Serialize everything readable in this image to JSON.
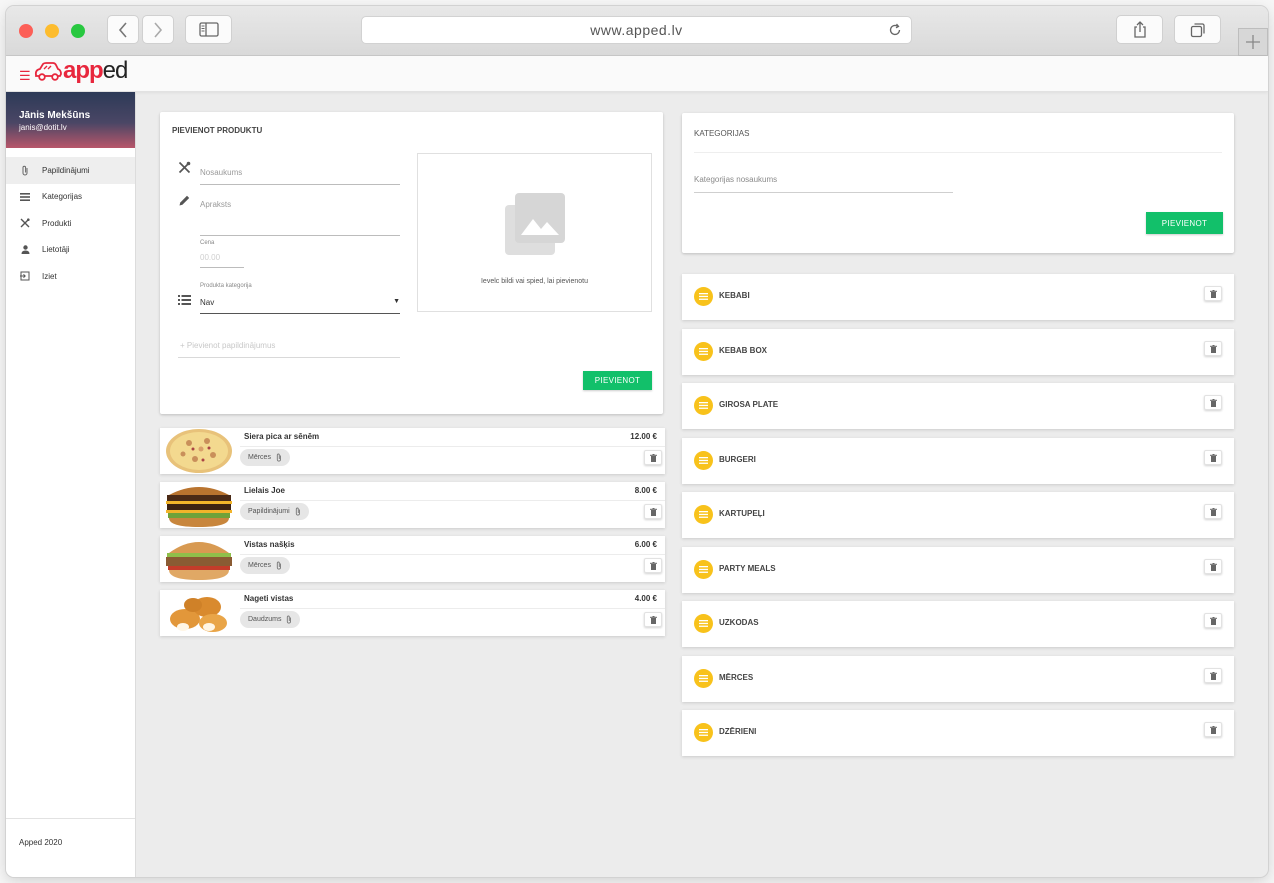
{
  "browser": {
    "url": "www.apped.lv"
  },
  "app": {
    "logo_part1": "app",
    "logo_part2": "ed",
    "user": {
      "name": "Jānis Mekšūns",
      "email": "janis@dotit.lv"
    },
    "nav": [
      {
        "label": "Papildinājumi",
        "icon": "paperclip-icon",
        "active": true
      },
      {
        "label": "Kategorijas",
        "icon": "list-icon",
        "active": false
      },
      {
        "label": "Produkti",
        "icon": "utensils-icon",
        "active": false
      },
      {
        "label": "Lietotāji",
        "icon": "person-icon",
        "active": false
      },
      {
        "label": "Iziet",
        "icon": "logout-icon",
        "active": false
      }
    ],
    "footer": "Apped 2020"
  },
  "add_product": {
    "title": "PIEVIENOT PRODUKTU",
    "name_placeholder": "Nosaukums",
    "description_placeholder": "Apraksts",
    "price_label": "Cena",
    "price_placeholder": "00.00",
    "category_label": "Produkta kategorija",
    "category_value": "Nav",
    "addon_placeholder": "+ Pievienot papildinājumus",
    "image_hint": "Ievelc bildi vai spied, lai pievienotu",
    "submit_label": "PIEVIENOT"
  },
  "products": [
    {
      "name": "Siera pica ar sēnēm",
      "price": "12.00 €",
      "tag": "Mērces",
      "image": "pizza"
    },
    {
      "name": "Lielais Joe",
      "price": "8.00 €",
      "tag": "Papildinājumi",
      "image": "burger-double"
    },
    {
      "name": "Vistas našķis",
      "price": "6.00 €",
      "tag": "Mērces",
      "image": "burger-chicken"
    },
    {
      "name": "Nageti vistas",
      "price": "4.00 €",
      "tag": "Daudzums",
      "image": "nuggets"
    }
  ],
  "categories_panel": {
    "title": "KATEGORIJAS",
    "name_placeholder": "Kategorijas nosaukums",
    "submit_label": "PIEVIENOT"
  },
  "categories": [
    {
      "name": "KEBABI"
    },
    {
      "name": "KEBAB BOX"
    },
    {
      "name": "GIROSA PLATE"
    },
    {
      "name": "BURGERI"
    },
    {
      "name": "KARTUPEĻI"
    },
    {
      "name": "PARTY MEALS"
    },
    {
      "name": "UZKODAS"
    },
    {
      "name": "MĒRCES"
    },
    {
      "name": "DZĒRIENI"
    }
  ],
  "colors": {
    "brand": "#e8273d",
    "accent_green": "#12c06a",
    "category_icon": "#f8c21b"
  }
}
